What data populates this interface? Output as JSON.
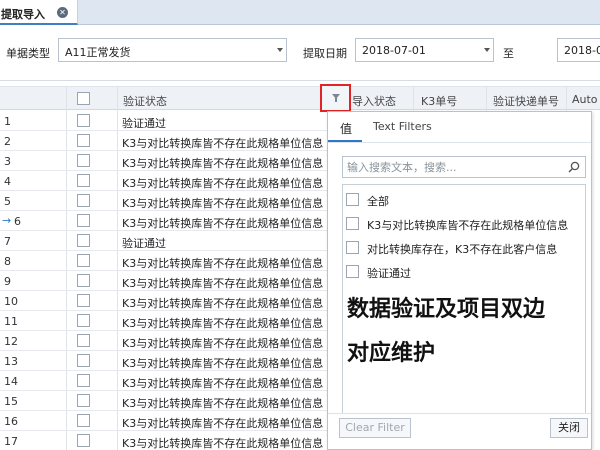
{
  "tab": {
    "label": "提取导入",
    "close_icon": "close-icon"
  },
  "filters": {
    "doc_type_label": "单据类型",
    "doc_type_value": "A11正常发货",
    "extract_date_label": "提取日期",
    "date_from": "2018-07-01",
    "to_label": "至",
    "date_to": "2018-0"
  },
  "grid": {
    "columns": [
      "验证状态",
      "导入状态",
      "K3单号",
      "验证快递单号",
      "Auto"
    ],
    "rows": [
      {
        "num": "1",
        "status": "验证通过"
      },
      {
        "num": "2",
        "status": "K3与对比转换库皆不存在此规格单位信息"
      },
      {
        "num": "3",
        "status": "K3与对比转换库皆不存在此规格单位信息"
      },
      {
        "num": "4",
        "status": "K3与对比转换库皆不存在此规格单位信息"
      },
      {
        "num": "5",
        "status": "K3与对比转换库皆不存在此规格单位信息"
      },
      {
        "num": "6",
        "status": "K3与对比转换库皆不存在此规格单位信息",
        "current": true
      },
      {
        "num": "7",
        "status": "验证通过"
      },
      {
        "num": "8",
        "status": "K3与对比转换库皆不存在此规格单位信息"
      },
      {
        "num": "9",
        "status": "K3与对比转换库皆不存在此规格单位信息"
      },
      {
        "num": "10",
        "status": "K3与对比转换库皆不存在此规格单位信息"
      },
      {
        "num": "11",
        "status": "K3与对比转换库皆不存在此规格单位信息"
      },
      {
        "num": "12",
        "status": "K3与对比转换库皆不存在此规格单位信息"
      },
      {
        "num": "13",
        "status": "K3与对比转换库皆不存在此规格单位信息"
      },
      {
        "num": "14",
        "status": "K3与对比转换库皆不存在此规格单位信息"
      },
      {
        "num": "15",
        "status": "K3与对比转换库皆不存在此规格单位信息"
      },
      {
        "num": "16",
        "status": "K3与对比转换库皆不存在此规格单位信息"
      },
      {
        "num": "17",
        "status": "K3与对比转换库皆不存在此规格单位信息"
      }
    ]
  },
  "popup": {
    "tab_values": "值",
    "tab_text_filters": "Text Filters",
    "search_placeholder": "输入搜索文本，搜索...",
    "items": [
      "全部",
      "K3与对比转换库皆不存在此规格单位信息",
      "对比转换库存在，K3不存在此客户信息",
      "验证通过"
    ],
    "overlay_line1": "数据验证及项目双边",
    "overlay_line2": "对应维护",
    "clear_filter": "Clear Filter",
    "close": "关闭"
  },
  "colors": {
    "accent": "#2f78c4",
    "highlight_border": "#e12424"
  }
}
